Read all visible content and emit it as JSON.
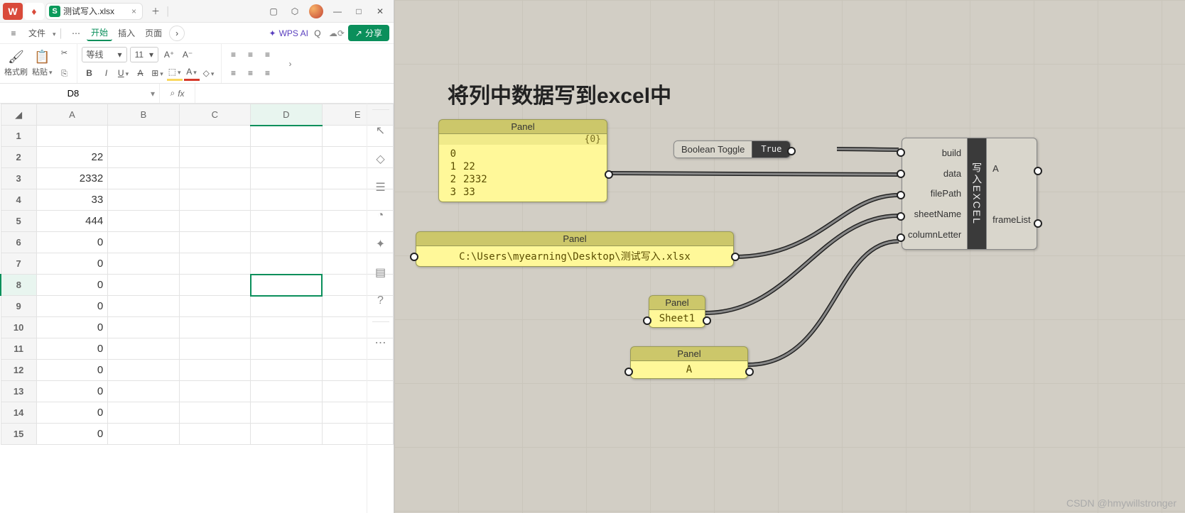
{
  "wps": {
    "app_badge": "W",
    "tab": {
      "badge": "S",
      "filename": "测试写入.xlsx",
      "close": "×"
    },
    "menu": {
      "file": "文件",
      "items": [
        "开始",
        "插入",
        "页面"
      ],
      "active": "开始",
      "more": "⋯",
      "wpsai": "WPS AI",
      "share": "分享"
    },
    "ribbon": {
      "brush": "格式刷",
      "paste": "粘贴",
      "font_name": "等线",
      "font_size": "11"
    },
    "cell_ref": "D8",
    "formula": "",
    "columns": [
      "A",
      "B",
      "C",
      "D",
      "E"
    ],
    "rows": [
      {
        "n": 1,
        "a": "<null>",
        "t": "txt"
      },
      {
        "n": 2,
        "a": "22"
      },
      {
        "n": 3,
        "a": "2332"
      },
      {
        "n": 4,
        "a": "33"
      },
      {
        "n": 5,
        "a": "444"
      },
      {
        "n": 6,
        "a": "0"
      },
      {
        "n": 7,
        "a": "0"
      },
      {
        "n": 8,
        "a": "0",
        "sel": true
      },
      {
        "n": 9,
        "a": "0"
      },
      {
        "n": 10,
        "a": "0"
      },
      {
        "n": 11,
        "a": "0"
      },
      {
        "n": 12,
        "a": "0"
      },
      {
        "n": 13,
        "a": "0"
      },
      {
        "n": 14,
        "a": "0"
      },
      {
        "n": 15,
        "a": "0"
      }
    ]
  },
  "gh": {
    "title": "将列中数据写到excel中",
    "panel1": {
      "title": "Panel",
      "tree": "{0}",
      "items": [
        {
          "i": "0",
          "v": "<null>"
        },
        {
          "i": "1",
          "v": "22"
        },
        {
          "i": "2",
          "v": "2332"
        },
        {
          "i": "3",
          "v": "33"
        }
      ]
    },
    "panel2": {
      "title": "Panel",
      "value": "C:\\Users\\myearning\\Desktop\\测试写入.xlsx"
    },
    "panel3": {
      "title": "Panel",
      "value": "Sheet1"
    },
    "panel4": {
      "title": "Panel",
      "value": "A"
    },
    "toggle": {
      "label": "Boolean Toggle",
      "value": "True"
    },
    "excel": {
      "inputs": [
        "build",
        "data",
        "filePath",
        "sheetName",
        "columnLetter"
      ],
      "center": "写入EXCEL",
      "outputs": [
        "A",
        "frameList"
      ]
    }
  },
  "watermark": "CSDN @hmywillstronger"
}
